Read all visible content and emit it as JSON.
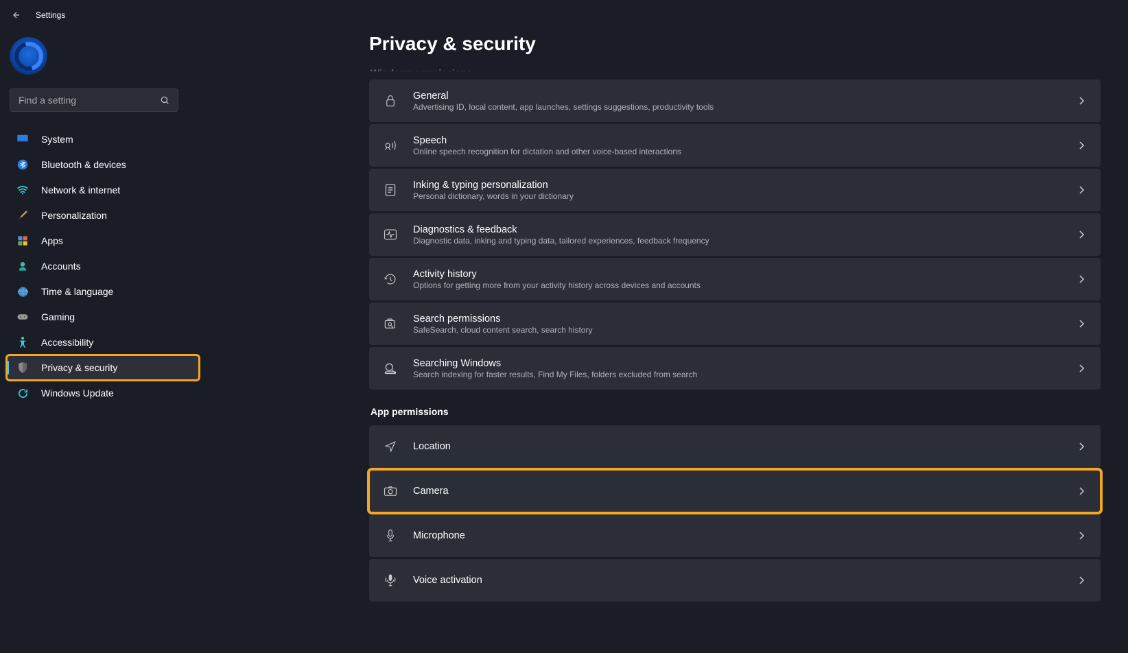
{
  "header": {
    "title": "Settings"
  },
  "search": {
    "placeholder": "Find a setting"
  },
  "sidebar": {
    "items": [
      {
        "label": "System",
        "icon": "monitor"
      },
      {
        "label": "Bluetooth & devices",
        "icon": "bluetooth"
      },
      {
        "label": "Network & internet",
        "icon": "wifi"
      },
      {
        "label": "Personalization",
        "icon": "brush"
      },
      {
        "label": "Apps",
        "icon": "apps"
      },
      {
        "label": "Accounts",
        "icon": "person"
      },
      {
        "label": "Time & language",
        "icon": "globe"
      },
      {
        "label": "Gaming",
        "icon": "gamepad"
      },
      {
        "label": "Accessibility",
        "icon": "accessibility"
      },
      {
        "label": "Privacy & security",
        "icon": "shield"
      },
      {
        "label": "Windows Update",
        "icon": "update"
      }
    ],
    "activeIndex": 9
  },
  "page": {
    "title": "Privacy & security"
  },
  "sections": {
    "windows_permissions": {
      "title": "Windows permissions",
      "items": [
        {
          "icon": "lock",
          "title": "General",
          "desc": "Advertising ID, local content, app launches, settings suggestions, productivity tools"
        },
        {
          "icon": "speech",
          "title": "Speech",
          "desc": "Online speech recognition for dictation and other voice-based interactions"
        },
        {
          "icon": "inking",
          "title": "Inking & typing personalization",
          "desc": "Personal dictionary, words in your dictionary"
        },
        {
          "icon": "diagnostics",
          "title": "Diagnostics & feedback",
          "desc": "Diagnostic data, inking and typing data, tailored experiences, feedback frequency"
        },
        {
          "icon": "activity",
          "title": "Activity history",
          "desc": "Options for getting more from your activity history across devices and accounts"
        },
        {
          "icon": "search-perms",
          "title": "Search permissions",
          "desc": "SafeSearch, cloud content search, search history"
        },
        {
          "icon": "search-windows",
          "title": "Searching Windows",
          "desc": "Search indexing for faster results, Find My Files, folders excluded from search"
        }
      ]
    },
    "app_permissions": {
      "title": "App permissions",
      "items": [
        {
          "icon": "location",
          "title": "Location",
          "desc": ""
        },
        {
          "icon": "camera",
          "title": "Camera",
          "desc": "",
          "highlighted": true
        },
        {
          "icon": "microphone",
          "title": "Microphone",
          "desc": ""
        },
        {
          "icon": "voice",
          "title": "Voice activation",
          "desc": ""
        }
      ]
    }
  }
}
